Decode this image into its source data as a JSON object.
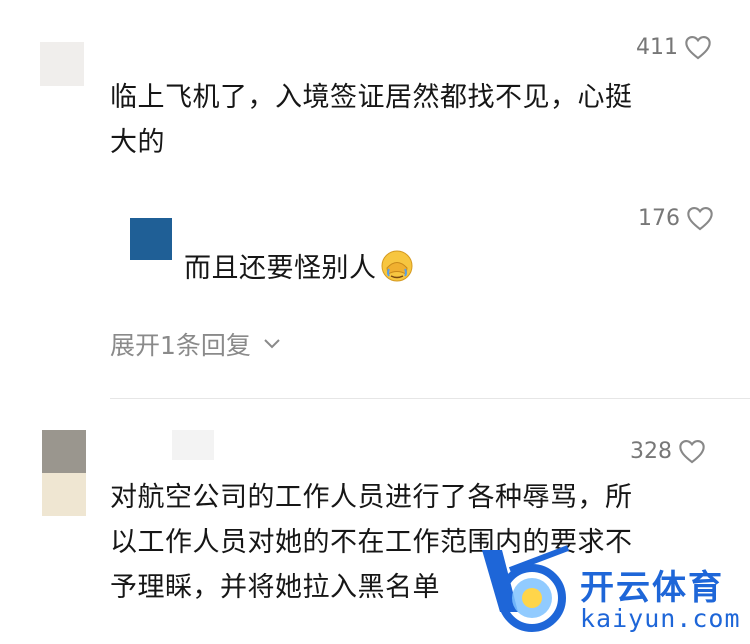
{
  "comments": [
    {
      "likes": "411",
      "lines": [
        "临上飞机了，入境签证居然都找不见，心挺",
        "大的"
      ]
    },
    {
      "likes": "328",
      "lines": [
        "对航空公司的工作人员进行了各种辱骂，所",
        "以工作人员对她的不在工作范围内的要求不",
        "予理睬，并将她拉入黑名单"
      ]
    }
  ],
  "reply": {
    "likes": "176",
    "text": "而且还要怪别人"
  },
  "expand_replies": "展开1条回复",
  "watermark": {
    "cn": "开云体育",
    "en": "kaiyun.com"
  },
  "icons": [
    "heart-icon",
    "chevron-down-icon",
    "face-palm-emoji-icon",
    "kaiyun-logo-icon"
  ],
  "colors": {
    "accent": "#1e66d8",
    "muted": "#8a8a8a"
  }
}
